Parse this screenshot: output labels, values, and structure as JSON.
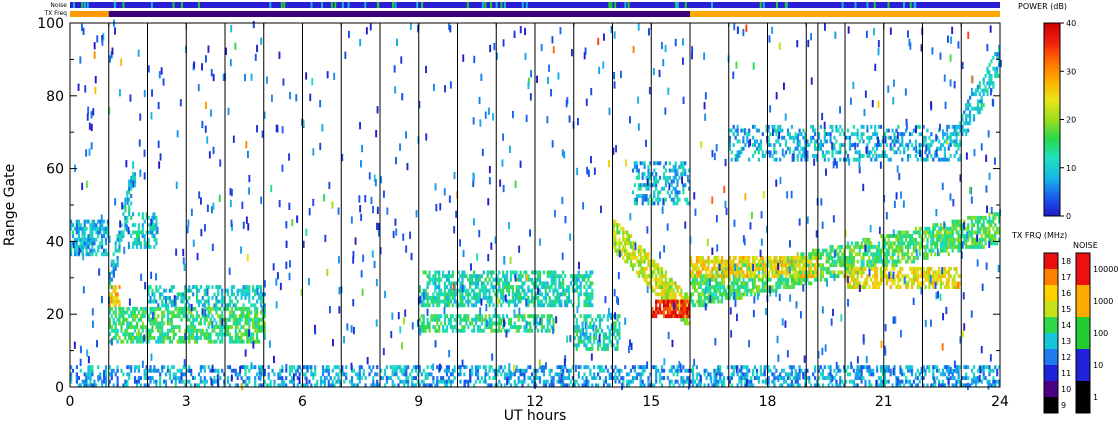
{
  "chart_data": {
    "type": "heatmap",
    "title": "",
    "xlabel": "UT hours",
    "ylabel": "Range Gate",
    "xlim": [
      0,
      24
    ],
    "ylim": [
      0,
      100
    ],
    "x_ticks": [
      "0",
      "3",
      "6",
      "9",
      "12",
      "15",
      "18",
      "21",
      "24"
    ],
    "y_ticks": [
      "0",
      "20",
      "40",
      "60",
      "80",
      "100"
    ],
    "grid": false,
    "scan_boundaries_ut": [
      1,
      2,
      3,
      4,
      5,
      6,
      7,
      8,
      9,
      10,
      11,
      12,
      13,
      14,
      15,
      16,
      17,
      18,
      19,
      19.3,
      20,
      21,
      22,
      23
    ],
    "top_strips": {
      "noise_label": "Noise",
      "txfreq_label": "TX Freq",
      "noise_color": "#2b1fd6",
      "txfreq_color_before": "#ff9a00",
      "txfreq_color_middle": "#3a0078",
      "txfreq_color_after": "#ffa800",
      "txfreq_low_interval_ut": [
        1,
        16
      ]
    },
    "power_colorbar": {
      "title": "POWER (dB)",
      "ticks": [
        "0",
        "10",
        "20",
        "30",
        "40"
      ],
      "range": [
        0,
        40
      ]
    },
    "txfreq_colorbar": {
      "title": "TX FRQ (MHz)",
      "ticks": [
        "9",
        "10",
        "11",
        "12",
        "13",
        "14",
        "15",
        "16",
        "17",
        "18"
      ],
      "colors": [
        "#000000",
        "#4b0082",
        "#1e22d8",
        "#1e7cf0",
        "#16c6d8",
        "#2fd84a",
        "#c8e21a",
        "#ffd000",
        "#ff8000",
        "#e81010"
      ]
    },
    "noise_colorbar": {
      "title": "NOISE",
      "ticks": [
        "1",
        "10",
        "100",
        "1000",
        "10000"
      ],
      "colors": [
        "#000000",
        "#2222dd",
        "#20cc30",
        "#ffaa00",
        "#ee1010"
      ]
    },
    "echo_regions": [
      {
        "x": [
          0.0,
          1.0
        ],
        "y_start": 36,
        "y_end": 46,
        "power": 9,
        "density": 0.7
      },
      {
        "x": [
          1.0,
          1.7
        ],
        "y_start": 28,
        "y_end": 62,
        "power": 10,
        "density": 0.55
      },
      {
        "x": [
          1.0,
          1.3
        ],
        "y_start": 22,
        "y_end": 28,
        "power": 26,
        "density": 0.8
      },
      {
        "x": [
          1.5,
          2.2
        ],
        "y_start": 38,
        "y_end": 48,
        "power": 11,
        "density": 0.5
      },
      {
        "x": [
          1.0,
          5.0
        ],
        "y_start": 12,
        "y_end": 22,
        "power": 15,
        "density": 0.65
      },
      {
        "x": [
          2.0,
          5.0
        ],
        "y_start": 22,
        "y_end": 28,
        "power": 10,
        "density": 0.5
      },
      {
        "x": [
          9.0,
          13.5
        ],
        "y_start": 22,
        "y_end": 32,
        "power": 12,
        "density": 0.6
      },
      {
        "x": [
          9.0,
          12.5
        ],
        "y_start": 15,
        "y_end": 20,
        "power": 14,
        "density": 0.6
      },
      {
        "x": [
          13.0,
          14.2
        ],
        "y_start": 10,
        "y_end": 20,
        "power": 12,
        "density": 0.55
      },
      {
        "x": [
          14.0,
          16.0
        ],
        "y_start": 42,
        "y_end": 20,
        "power": 22,
        "density": 0.7
      },
      {
        "x": [
          15.0,
          16.0
        ],
        "y_start": 19,
        "y_end": 24,
        "power": 36,
        "density": 0.85
      },
      {
        "x": [
          14.5,
          16.0
        ],
        "y_start": 50,
        "y_end": 62,
        "power": 9,
        "density": 0.4
      },
      {
        "x": [
          16.0,
          24.0
        ],
        "y_start": 26,
        "y_end": 44,
        "power": 16,
        "density": 0.7
      },
      {
        "x": [
          16.0,
          19.3
        ],
        "y_start": 30,
        "y_end": 36,
        "power": 25,
        "density": 0.7
      },
      {
        "x": [
          20.0,
          23.0
        ],
        "y_start": 27,
        "y_end": 33,
        "power": 24,
        "density": 0.6
      },
      {
        "x": [
          17.0,
          23.0
        ],
        "y_start": 62,
        "y_end": 72,
        "power": 9,
        "density": 0.35
      },
      {
        "x": [
          22.8,
          24.0
        ],
        "y_start": 68,
        "y_end": 90,
        "power": 10,
        "density": 0.5
      },
      {
        "x": [
          0.0,
          24.0
        ],
        "y_start": 0,
        "y_end": 6,
        "power": 8,
        "density": 0.45
      }
    ]
  }
}
